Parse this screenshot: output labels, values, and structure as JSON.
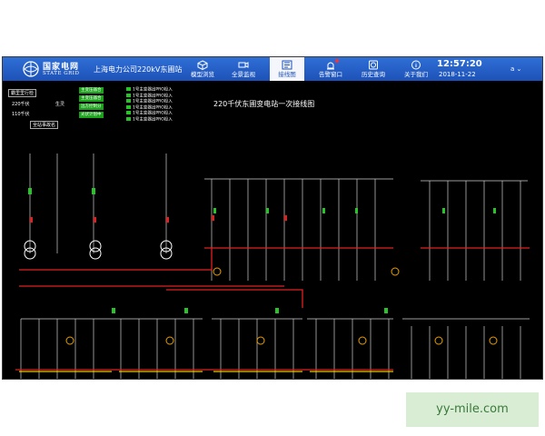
{
  "header": {
    "logo_cn": "国家电网",
    "logo_en": "STATE GRID",
    "station": "上海电力公司220kV东圃站",
    "clock": "12:57:20",
    "date": "2018-11-22",
    "user": "a",
    "nav": [
      {
        "label": "模型浏览",
        "icon": "cube-icon",
        "active": false
      },
      {
        "label": "全景监视",
        "icon": "camera-icon",
        "active": false
      },
      {
        "label": "接线图",
        "icon": "wiring-icon",
        "active": true
      },
      {
        "label": "告警窗口",
        "icon": "alarm-icon",
        "active": false
      },
      {
        "label": "历史查询",
        "icon": "history-icon",
        "active": false
      },
      {
        "label": "关于我们",
        "icon": "info-icon",
        "active": false
      }
    ]
  },
  "diagram": {
    "title": "220千伏东圃变电站一次接线图",
    "panel_header": "霸里里行检",
    "panel_rows": [
      "220千伏",
      "110千伏",
      "生灵"
    ],
    "panel_button": "全站事故名",
    "green_buttons": [
      "主变压器合",
      "主变压器合",
      "远方控制分",
      "光伏计划中"
    ],
    "legend": [
      "1号主变器出PRO投入",
      "1号主变器出PRO投入",
      "1号主变器出PRO投入",
      "1号主变器出PRO投入",
      "1号主变器出PRO投入",
      "1号主变器出PRO投入"
    ]
  },
  "watermark": "yy-mile.com",
  "colors": {
    "header_blue": "#1d52b8",
    "bus_red": "#e02020",
    "breaker_green": "#27c427",
    "line_white": "#dddddd",
    "tag_yellow": "#f0d000"
  }
}
